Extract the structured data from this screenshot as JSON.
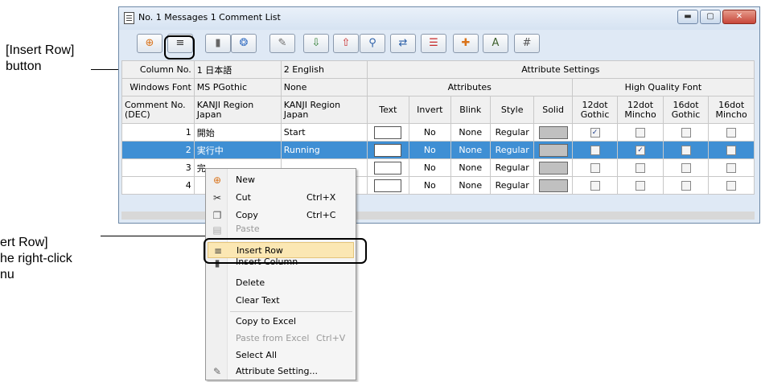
{
  "callouts": {
    "insert_button_line1": "[Insert Row]",
    "insert_button_line2": "button",
    "menu_line1": "ert Row]",
    "menu_line2": "he right-click",
    "menu_line3": "nu"
  },
  "window": {
    "title": "No. 1 Messages 1 Comment List",
    "minimize_glyph": "▬",
    "maximize_glyph": "▢",
    "close_glyph": "✕"
  },
  "toolbar": [
    {
      "name": "new-row-icon",
      "glyph": "⊕",
      "color": "#d9731a"
    },
    {
      "name": "insert-row-icon",
      "glyph": "≡",
      "color": "#333333"
    },
    {
      "name": "insert-column-icon",
      "glyph": "▮",
      "color": "#666666"
    },
    {
      "name": "attribute-icon",
      "glyph": "❂",
      "color": "#3b73c4"
    },
    {
      "name": "attribute-setting-icon",
      "glyph": "✎",
      "color": "#6b6b6b"
    },
    {
      "name": "import-excel-icon",
      "glyph": "⇩",
      "color": "#2e7d32"
    },
    {
      "name": "export-excel-icon",
      "glyph": "⇧",
      "color": "#c62828"
    },
    {
      "name": "find-icon",
      "glyph": "⚲",
      "color": "#2b5fa8"
    },
    {
      "name": "replace-icon",
      "glyph": "⇄",
      "color": "#2b5fa8"
    },
    {
      "name": "list-icon",
      "glyph": "☰",
      "color": "#c62828"
    },
    {
      "name": "add-comment-icon",
      "glyph": "✚",
      "color": "#d9731a"
    },
    {
      "name": "font-icon",
      "glyph": "A",
      "color": "#3b5e2b"
    },
    {
      "name": "dec-hex-icon",
      "glyph": "#",
      "color": "#555555"
    }
  ],
  "grid": {
    "row1": {
      "col_no": "Column No.",
      "lang1": "1 日本語",
      "lang2": "2 English",
      "attr_settings": "Attribute Settings"
    },
    "row2": {
      "windows_font": "Windows Font",
      "font1": "MS PGothic",
      "font2": "None",
      "attributes": "Attributes",
      "hq_font": "High Quality Font"
    },
    "row3": {
      "comment_no": "Comment No. (DEC)",
      "kanji1": "KANJI Region Japan",
      "kanji2": "KANJI Region Japan",
      "text": "Text",
      "invert": "Invert",
      "blink": "Blink",
      "style": "Style",
      "solid": "Solid",
      "g12": "12dot Gothic",
      "m12": "12dot Mincho",
      "g16": "16dot Gothic",
      "m16": "16dot Mincho"
    },
    "rows": [
      {
        "no": "1",
        "jp": "開始",
        "en": "Start",
        "invert": "No",
        "blink": "None",
        "style": "Regular",
        "checks": [
          true,
          false,
          false,
          false
        ]
      },
      {
        "no": "2",
        "jp": "実行中",
        "en": "Running",
        "invert": "No",
        "blink": "None",
        "style": "Regular",
        "checks": [
          false,
          true,
          false,
          false
        ]
      },
      {
        "no": "3",
        "jp": "完",
        "en": "",
        "invert": "No",
        "blink": "None",
        "style": "Regular",
        "checks": [
          false,
          false,
          false,
          false
        ]
      },
      {
        "no": "4",
        "jp": "",
        "en": "",
        "invert": "No",
        "blink": "None",
        "style": "Regular",
        "checks": [
          false,
          false,
          false,
          false
        ]
      }
    ]
  },
  "menu": {
    "new": "New",
    "cut": "Cut",
    "cut_sc": "Ctrl+X",
    "copy": "Copy",
    "copy_sc": "Ctrl+C",
    "paste": "Paste",
    "insert_row": "Insert Row",
    "insert_column": "Insert Column",
    "delete": "Delete",
    "clear_text": "Clear Text",
    "copy_excel": "Copy to Excel",
    "paste_excel": "Paste from Excel",
    "paste_excel_sc": "Ctrl+V",
    "select_all": "Select All",
    "attr_setting": "Attribute Setting..."
  },
  "colors": {
    "selection": "#3f8fd4",
    "highlight": "#fbe7b3"
  }
}
